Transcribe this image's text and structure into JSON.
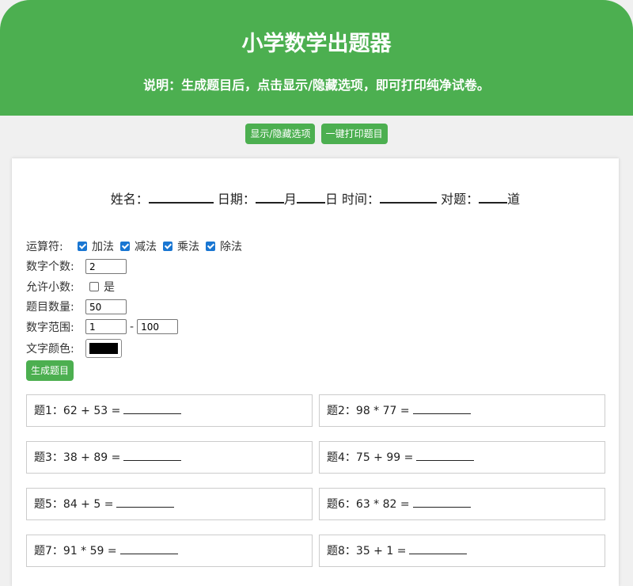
{
  "header": {
    "title": "小学数学出题器",
    "subtitle": "说明：生成题目后，点击显示/隐藏选项，即可打印纯净试卷。"
  },
  "toolbar": {
    "toggle_label": "显示/隐藏选项",
    "print_label": "一键打印题目"
  },
  "info": {
    "name_label": "姓名：",
    "date_label": "日期：",
    "month_label": "月",
    "day_label": "日",
    "time_label": "时间：",
    "correct_label": "对题：",
    "count_unit": "道"
  },
  "options": {
    "operator_label": "运算符:",
    "operators": [
      {
        "label": "加法",
        "checked": true
      },
      {
        "label": "减法",
        "checked": true
      },
      {
        "label": "乘法",
        "checked": true
      },
      {
        "label": "除法",
        "checked": true
      }
    ],
    "num_count_label": "数字个数:",
    "num_count_value": "2",
    "decimal_label": "允许小数:",
    "decimal_option": "是",
    "decimal_checked": false,
    "question_count_label": "题目数量:",
    "question_count_value": "50",
    "range_label": "数字范围:",
    "range_min": "1",
    "range_sep": "-",
    "range_max": "100",
    "color_label": "文字颜色:",
    "text_color": "#000000",
    "generate_label": "生成题目"
  },
  "questions": [
    {
      "prefix": "题1：",
      "expr": "62 + 53 ="
    },
    {
      "prefix": "题2：",
      "expr": "98 * 77 ="
    },
    {
      "prefix": "题3：",
      "expr": "38 + 89 ="
    },
    {
      "prefix": "题4：",
      "expr": "75 + 99 ="
    },
    {
      "prefix": "题5：",
      "expr": "84 + 5 ="
    },
    {
      "prefix": "题6：",
      "expr": "63 * 82 ="
    },
    {
      "prefix": "题7：",
      "expr": "91 * 59 ="
    },
    {
      "prefix": "题8：",
      "expr": "35 + 1 ="
    }
  ],
  "colors": {
    "accent": "#4caf50",
    "checkbox": "#1976d2"
  }
}
